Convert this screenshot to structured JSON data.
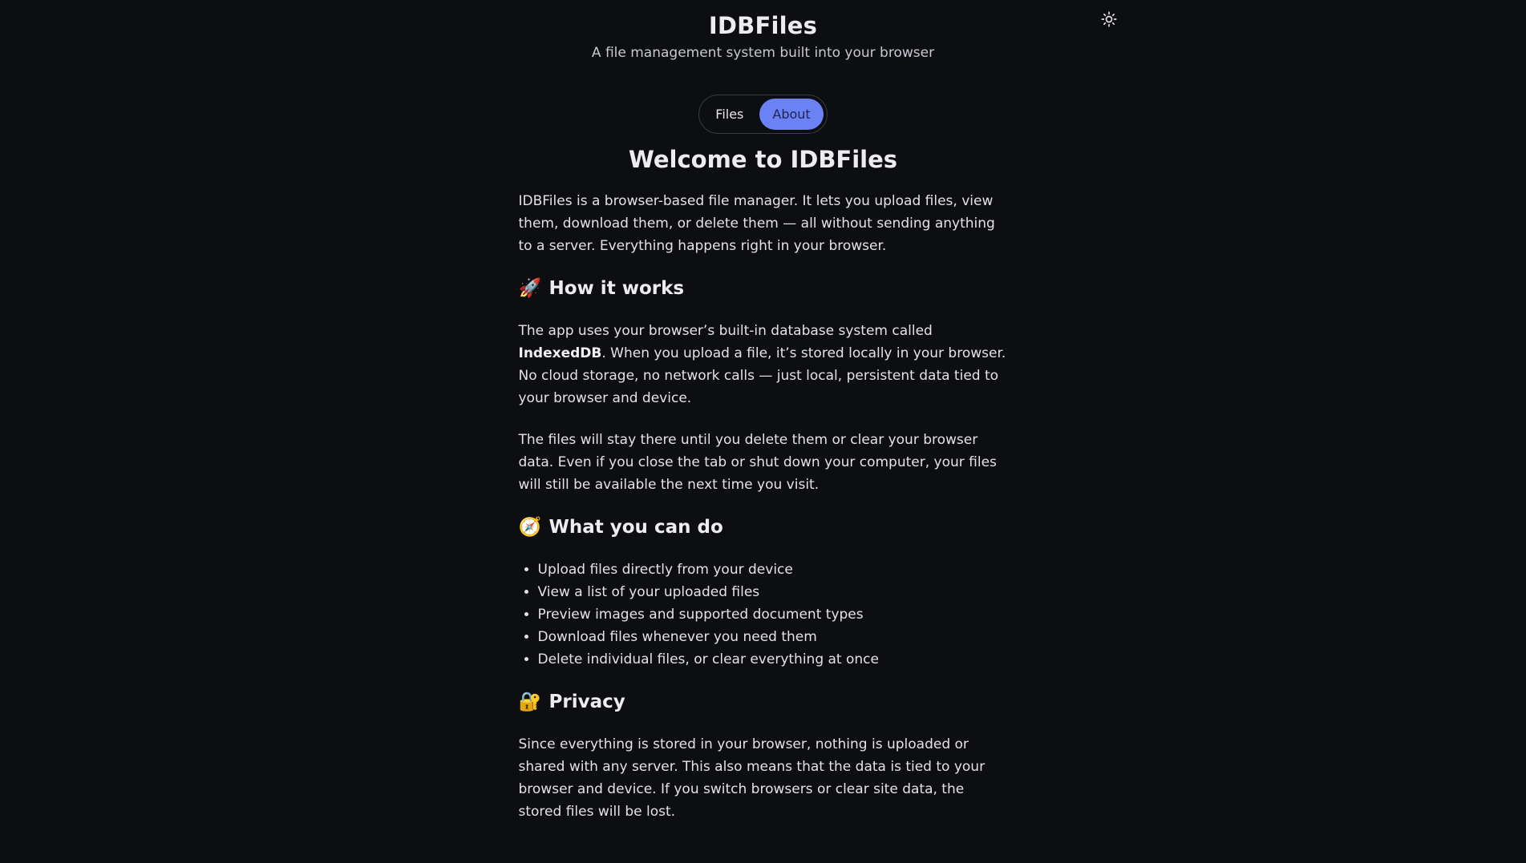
{
  "header": {
    "title": "IDBFiles",
    "subtitle": "A file management system built into your browser",
    "theme_toggle_icon": "sun-icon"
  },
  "tabs": [
    {
      "label": "Files",
      "active": false
    },
    {
      "label": "About",
      "active": true
    }
  ],
  "about": {
    "title": "Welcome to IDBFiles",
    "intro": "IDBFiles is a browser-based file manager. It lets you upload files, view them, download them, or delete them — all without sending anything to a server. Everything happens right in your browser.",
    "how_it_works": {
      "emoji": "🚀",
      "heading": "How it works",
      "p1_before": "The app uses your browser’s built-in database system called ",
      "p1_strong": "IndexedDB",
      "p1_after": ". When you upload a file, it’s stored locally in your browser. No cloud storage, no network calls — just local, persistent data tied to your browser and device.",
      "p2": "The files will stay there until you delete them or clear your browser data. Even if you close the tab or shut down your computer, your files will still be available the next time you visit."
    },
    "what_you_can_do": {
      "emoji": "🧭",
      "heading": "What you can do",
      "items": [
        "Upload files directly from your device",
        "View a list of your uploaded files",
        "Preview images and supported document types",
        "Download files whenever you need them",
        "Delete individual files, or clear everything at once"
      ]
    },
    "privacy": {
      "emoji": "🔐",
      "heading": "Privacy",
      "p1": "Since everything is stored in your browser, nothing is uploaded or shared with any server. This also means that the data is tied to your browser and device. If you switch browsers or clear site data, the stored files will be lost."
    }
  },
  "colors": {
    "background": "#0d0e12",
    "accent": "#6b82f5"
  }
}
